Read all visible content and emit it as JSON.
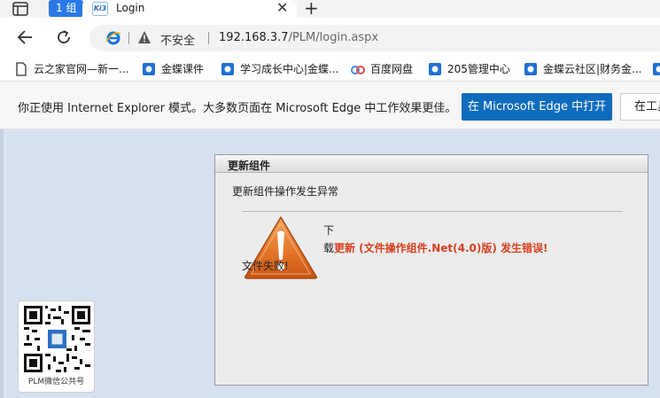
{
  "browser": {
    "tab_group_label": "1 组",
    "tab_icon_text": "Ki3",
    "tab_title": "Login",
    "tab_close": "✕",
    "new_tab": "+",
    "security_label": "不安全",
    "url_host": "192.168.3.7",
    "url_path": "/PLM/login.aspx"
  },
  "favorites": [
    {
      "label": "云之家官网—新一...",
      "icon": "page-icon"
    },
    {
      "label": "金蝶课件",
      "icon": "kingdee-icon"
    },
    {
      "label": "学习成长中心|金蝶...",
      "icon": "kingdee-icon"
    },
    {
      "label": "百度网盘",
      "icon": "cloud-icon"
    },
    {
      "label": "205管理中心",
      "icon": "kingdee-icon"
    },
    {
      "label": "金蝶云社区|财务金...",
      "icon": "kingdee-icon"
    }
  ],
  "ie_banner": {
    "message": "你正使用 Internet Explorer 模式。大多数页面在 Microsoft Edge 中工作效果更佳。",
    "open_button": "在 Microsoft Edge 中打开",
    "tools_button": "在工具"
  },
  "dialog": {
    "title": "更新组件",
    "subtitle": "更新组件操作发生异常",
    "fail_text": "文件失败!",
    "download_line1": "下",
    "download_line2": "载",
    "error_message": "更新 (文件操作组件.Net(4.0)版) 发生错误!"
  },
  "qr": {
    "label": "PLM微信公共号"
  },
  "colors": {
    "edge_blue": "#0f6cbd",
    "error_red": "#d8401f",
    "group_blue": "#2b79e6"
  }
}
